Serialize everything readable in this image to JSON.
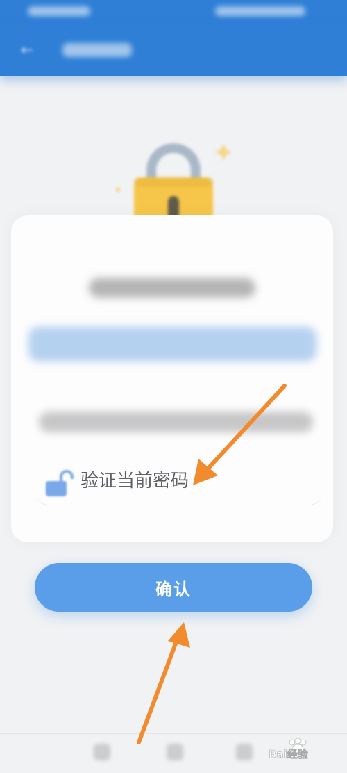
{
  "header": {
    "back_icon": "back-arrow-icon"
  },
  "password_field": {
    "placeholder": "验证当前密码",
    "value": "",
    "icon": "unlock-icon"
  },
  "confirm_button": {
    "label": "确认"
  },
  "watermark": {
    "text": "Bai经验"
  },
  "colors": {
    "primary": "#2f7fd6",
    "button": "#5a9de9",
    "background": "#f1f2f4",
    "card": "#fdfdfe",
    "lock_gold": "#f6c64a",
    "annotation_arrow": "#f28a2e"
  }
}
